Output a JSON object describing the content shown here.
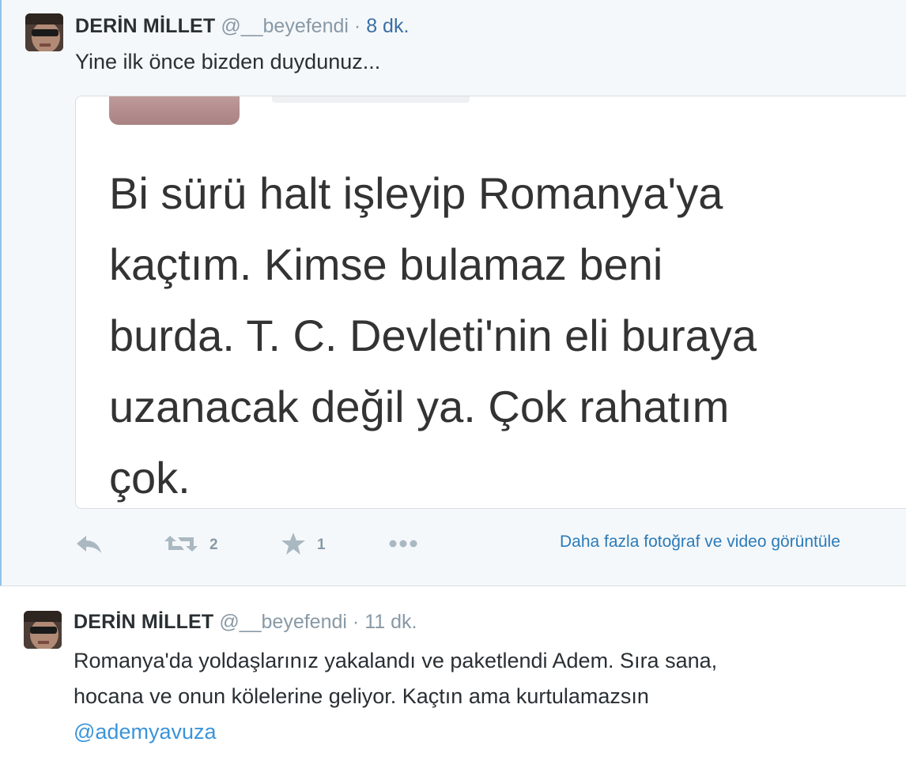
{
  "tweets": [
    {
      "author_name": "DERİN MİLLET",
      "author_handle": "@__beyefendi",
      "separator": "·",
      "time": "8 dk.",
      "text": "Yine ilk önce bizden duydunuz...",
      "media_text": "Bi sürü halt işleyip Romanya'ya\nkaçtım. Kimse bulamaz beni\nburda. T. C. Devleti'nin eli buraya\nuzanacak değil ya. Çok rahatım\nçok.",
      "retweet_count": "2",
      "favorite_count": "1",
      "more_media_link": "Daha fazla fotoğraf ve video görüntüle"
    },
    {
      "author_name": "DERİN MİLLET",
      "author_handle": "@__beyefendi",
      "separator": "·",
      "time": "11 dk.",
      "text_lines": [
        "Romanya'da yoldaşlarınız yakalandı ve paketlendi Adem. Sıra sana,",
        "hocana ve onun kölelerine geliyor. Kaçtın ama kurtulamazsın"
      ],
      "mention": "@ademyavuza"
    }
  ],
  "icons": {
    "reply": "reply-icon",
    "retweet": "retweet-icon",
    "favorite": "star-icon",
    "more": "more-dots-icon"
  },
  "colors": {
    "link": "#2b7bb9",
    "mention": "#3b94d9",
    "muted": "#8899a6",
    "highlight_border": "#8ec3ea"
  }
}
